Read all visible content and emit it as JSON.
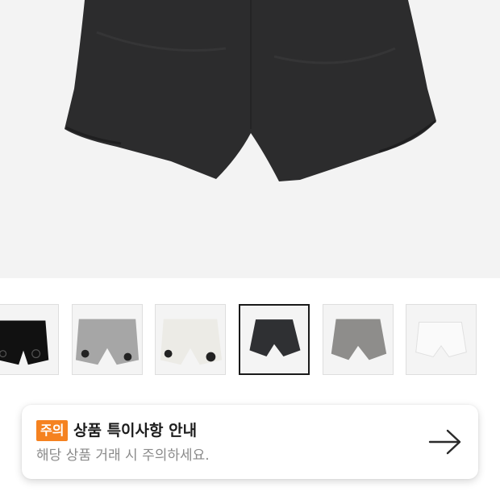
{
  "product": {
    "thumbnails": [
      {
        "name": "black-shorts-logo",
        "color": "#111111",
        "selected": false
      },
      {
        "name": "gray-shorts-logo",
        "color": "#a6a6a6",
        "selected": false
      },
      {
        "name": "ivory-shorts-logo",
        "color": "#ecebe6",
        "selected": false
      },
      {
        "name": "charcoal-shorts",
        "color": "#2f3033",
        "selected": true
      },
      {
        "name": "dark-gray-shorts",
        "color": "#8e8d8b",
        "selected": false
      },
      {
        "name": "white-shorts",
        "color": "#f6f6f6",
        "selected": false
      }
    ]
  },
  "notice": {
    "badge": "주의",
    "title": "상품 특이사항 안내",
    "description": "해당 상품 거래 시 주의하세요.",
    "arrow_icon": "arrow-right-icon",
    "badge_color": "#f58220"
  }
}
